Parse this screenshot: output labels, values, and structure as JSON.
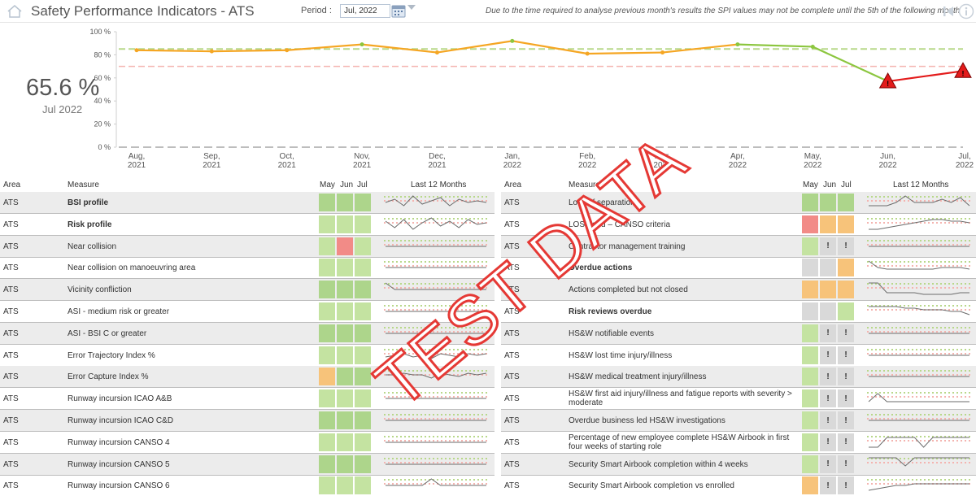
{
  "header": {
    "title": "Safety Performance Indicators - ATS",
    "period_label": "Period :",
    "period_value": "Jul, 2022",
    "notice": "Due to the time required to analyse previous month's results the SPI values may not be complete until the 5th of the following month"
  },
  "kpi": {
    "value": "65.6 %",
    "period": "Jul 2022"
  },
  "chart_data": {
    "type": "line",
    "x": [
      "Aug, 2021",
      "Sep, 2021",
      "Oct, 2021",
      "Nov, 2021",
      "Dec, 2021",
      "Jan, 2022",
      "Feb, 2022",
      "Mar, 2022",
      "Apr, 2022",
      "May, 2022",
      "Jun, 2022",
      "Jul, 2022"
    ],
    "y_ticks": [
      "100 %",
      "80 %",
      "60 %",
      "40 %",
      "20 %",
      "0 %"
    ],
    "ylim": [
      0,
      100
    ],
    "values": [
      84,
      83,
      84,
      89,
      82,
      92,
      81,
      82,
      89,
      87,
      57,
      66
    ],
    "target_line": 85,
    "threshold_line": 70,
    "zero_line": 0,
    "colors": {
      "above": "#8cc63f",
      "near": "#f5a623",
      "below": "#e31b1b",
      "target": "#b8d88a",
      "threshold": "#f4b4b0",
      "baseline": "#bdbdbd"
    },
    "alert_points": [
      10,
      11
    ]
  },
  "left_table": {
    "headers": {
      "area": "Area",
      "measure": "Measure",
      "m1": "May",
      "m2": "Jun",
      "m3": "Jul",
      "trend": "Last 12 Months"
    },
    "rows": [
      {
        "area": "ATS",
        "measure": "BSI profile",
        "bold": true,
        "cells": [
          "dgreen",
          "dgreen",
          "dgreen"
        ],
        "marks": [
          "",
          "",
          ""
        ],
        "spark": [
          5,
          7,
          3,
          9,
          4,
          6,
          8,
          3,
          7,
          5,
          6,
          5
        ]
      },
      {
        "area": "ATS",
        "measure": "Risk profile",
        "bold": true,
        "cells": [
          "green",
          "green",
          "green"
        ],
        "marks": [
          "",
          "",
          ""
        ],
        "spark": [
          7,
          3,
          8,
          2,
          6,
          9,
          4,
          7,
          3,
          8,
          5,
          6
        ]
      },
      {
        "area": "ATS",
        "measure": "Near collision",
        "bold": false,
        "cells": [
          "green",
          "red",
          "green"
        ],
        "marks": [
          "",
          "",
          ""
        ],
        "spark": [
          5,
          5,
          5,
          5,
          5,
          5,
          5,
          5,
          5,
          5,
          5,
          5
        ]
      },
      {
        "area": "ATS",
        "measure": "Near collision on manoeuvring area",
        "bold": false,
        "cells": [
          "green",
          "green",
          "green"
        ],
        "marks": [
          "",
          "",
          ""
        ],
        "spark": [
          5,
          5,
          5,
          5,
          5,
          5,
          5,
          5,
          5,
          5,
          5,
          5
        ]
      },
      {
        "area": "ATS",
        "measure": "Vicinity confliction",
        "bold": false,
        "cells": [
          "dgreen",
          "dgreen",
          "dgreen"
        ],
        "marks": [
          "",
          "",
          ""
        ],
        "spark": [
          9,
          5,
          5,
          5,
          5,
          5,
          5,
          5,
          5,
          5,
          5,
          5
        ]
      },
      {
        "area": "ATS",
        "measure": "ASI - medium risk or greater",
        "bold": false,
        "cells": [
          "green",
          "green",
          "green"
        ],
        "marks": [
          "",
          "",
          ""
        ],
        "spark": [
          5,
          5,
          5,
          5,
          5,
          5,
          5,
          5,
          5,
          5,
          5,
          5
        ]
      },
      {
        "area": "ATS",
        "measure": "ASI - BSI C or greater",
        "bold": false,
        "cells": [
          "dgreen",
          "dgreen",
          "dgreen"
        ],
        "marks": [
          "",
          "",
          ""
        ],
        "spark": [
          5,
          5,
          5,
          5,
          5,
          5,
          5,
          5,
          5,
          5,
          5,
          5
        ]
      },
      {
        "area": "ATS",
        "measure": "Error Trajectory Index %",
        "bold": false,
        "cells": [
          "green",
          "green",
          "green"
        ],
        "marks": [
          "",
          "",
          ""
        ],
        "spark": [
          4,
          5,
          6,
          4,
          5,
          3,
          6,
          5,
          4,
          6,
          5,
          6
        ]
      },
      {
        "area": "ATS",
        "measure": "Error Capture Index %",
        "bold": false,
        "cells": [
          "orange",
          "dgreen",
          "dgreen"
        ],
        "marks": [
          "",
          "",
          ""
        ],
        "spark": [
          6,
          6,
          7,
          6,
          6,
          4,
          7,
          6,
          5,
          7,
          6,
          7
        ]
      },
      {
        "area": "ATS",
        "measure": "Runway incursion ICAO A&B",
        "bold": false,
        "cells": [
          "green",
          "green",
          "green"
        ],
        "marks": [
          "",
          "",
          ""
        ],
        "spark": [
          5,
          5,
          5,
          5,
          5,
          5,
          5,
          5,
          5,
          5,
          5,
          5
        ]
      },
      {
        "area": "ATS",
        "measure": "Runway incursion ICAO C&D",
        "bold": false,
        "cells": [
          "dgreen",
          "dgreen",
          "dgreen"
        ],
        "marks": [
          "",
          "",
          ""
        ],
        "spark": [
          5,
          5,
          5,
          5,
          5,
          5,
          5,
          5,
          5,
          5,
          5,
          5
        ]
      },
      {
        "area": "ATS",
        "measure": "Runway incursion CANSO 4",
        "bold": false,
        "cells": [
          "green",
          "green",
          "green"
        ],
        "marks": [
          "",
          "",
          ""
        ],
        "spark": [
          5,
          5,
          5,
          5,
          5,
          5,
          5,
          5,
          5,
          5,
          5,
          5
        ]
      },
      {
        "area": "ATS",
        "measure": "Runway incursion CANSO 5",
        "bold": false,
        "cells": [
          "dgreen",
          "dgreen",
          "dgreen"
        ],
        "marks": [
          "",
          "",
          ""
        ],
        "spark": [
          5,
          5,
          5,
          5,
          5,
          5,
          5,
          5,
          5,
          5,
          5,
          5
        ]
      },
      {
        "area": "ATS",
        "measure": "Runway incursion CANSO 6",
        "bold": false,
        "cells": [
          "green",
          "green",
          "green"
        ],
        "marks": [
          "",
          "",
          ""
        ],
        "spark": [
          5,
          5,
          5,
          5,
          5,
          9,
          5,
          5,
          5,
          5,
          5,
          5
        ]
      }
    ]
  },
  "right_table": {
    "headers": {
      "area": "Area",
      "measure": "Measure",
      "m1": "May",
      "m2": "Jun",
      "m3": "Jul",
      "trend": "Last 12 Months"
    },
    "rows": [
      {
        "area": "ATS",
        "measure": "Loss of separation",
        "bold": false,
        "cells": [
          "dgreen",
          "dgreen",
          "dgreen"
        ],
        "marks": [
          "",
          "",
          ""
        ],
        "spark": [
          3,
          3,
          3,
          5,
          9,
          5,
          5,
          5,
          7,
          5,
          8,
          3
        ]
      },
      {
        "area": "ATS",
        "measure": "LOS trend – CANSO criteria",
        "bold": false,
        "cells": [
          "red",
          "orange",
          "orange"
        ],
        "marks": [
          "",
          "",
          ""
        ],
        "spark": [
          2,
          2,
          3,
          4,
          5,
          6,
          7,
          8,
          8,
          7,
          7,
          6
        ]
      },
      {
        "area": "ATS",
        "measure": "Contractor management training",
        "bold": false,
        "cells": [
          "green",
          "grey",
          "grey"
        ],
        "marks": [
          "",
          "!",
          "!"
        ],
        "spark": [
          5,
          5,
          5,
          5,
          5,
          5,
          5,
          5,
          5,
          5,
          5,
          5
        ]
      },
      {
        "area": "ATS",
        "measure": "Overdue actions",
        "bold": true,
        "cells": [
          "grey",
          "grey",
          "orange"
        ],
        "marks": [
          "",
          "",
          ""
        ],
        "spark": [
          9,
          5,
          4,
          4,
          4,
          4,
          4,
          4,
          5,
          5,
          5,
          4
        ]
      },
      {
        "area": "ATS",
        "measure": "Actions completed but not closed",
        "bold": false,
        "cells": [
          "orange",
          "orange",
          "orange"
        ],
        "marks": [
          "",
          "",
          ""
        ],
        "spark": [
          9,
          9,
          3,
          3,
          3,
          3,
          2,
          2,
          2,
          2,
          3,
          3
        ]
      },
      {
        "area": "ATS",
        "measure": "Risk reviews overdue",
        "bold": true,
        "cells": [
          "grey",
          "grey",
          "green"
        ],
        "marks": [
          "",
          "",
          ""
        ],
        "spark": [
          8,
          8,
          8,
          8,
          7,
          7,
          6,
          6,
          6,
          5,
          5,
          3
        ]
      },
      {
        "area": "ATS",
        "measure": "HS&W notifiable events",
        "bold": false,
        "cells": [
          "green",
          "grey",
          "grey"
        ],
        "marks": [
          "",
          "!",
          "!"
        ],
        "spark": [
          5,
          5,
          5,
          5,
          5,
          5,
          5,
          5,
          5,
          5,
          5,
          5
        ]
      },
      {
        "area": "ATS",
        "measure": "HS&W lost time injury/illness",
        "bold": false,
        "cells": [
          "green",
          "grey",
          "grey"
        ],
        "marks": [
          "",
          "!",
          "!"
        ],
        "spark": [
          5,
          5,
          5,
          5,
          5,
          5,
          5,
          5,
          5,
          5,
          5,
          5
        ]
      },
      {
        "area": "ATS",
        "measure": "HS&W medical treatment injury/illness",
        "bold": false,
        "cells": [
          "green",
          "grey",
          "grey"
        ],
        "marks": [
          "",
          "!",
          "!"
        ],
        "spark": [
          5,
          5,
          5,
          5,
          5,
          5,
          5,
          5,
          5,
          5,
          5,
          5
        ]
      },
      {
        "area": "ATS",
        "measure": "HS&W first aid injury/illness and fatigue reports with severity > moderate",
        "bold": false,
        "cells": [
          "green",
          "grey",
          "grey"
        ],
        "marks": [
          "",
          "!",
          "!"
        ],
        "spark": [
          3,
          8,
          3,
          3,
          3,
          3,
          3,
          3,
          3,
          3,
          3,
          3
        ]
      },
      {
        "area": "ATS",
        "measure": "Overdue business led HS&W investigations",
        "bold": false,
        "cells": [
          "green",
          "grey",
          "grey"
        ],
        "marks": [
          "",
          "!",
          "!"
        ],
        "spark": [
          5,
          5,
          5,
          5,
          5,
          5,
          5,
          5,
          5,
          5,
          5,
          5
        ]
      },
      {
        "area": "ATS",
        "measure": "Percentage of new employee complete HS&W Airbook in first four weeks of starting role",
        "bold": false,
        "cells": [
          "green",
          "grey",
          "grey"
        ],
        "marks": [
          "",
          "!",
          "!"
        ],
        "spark": [
          2,
          2,
          8,
          8,
          8,
          8,
          2,
          8,
          8,
          8,
          8,
          8
        ]
      },
      {
        "area": "ATS",
        "measure": "Security Smart Airbook completion within 4 weeks",
        "bold": false,
        "cells": [
          "green",
          "grey",
          "grey"
        ],
        "marks": [
          "",
          "!",
          "!"
        ],
        "spark": [
          9,
          9,
          9,
          9,
          4,
          9,
          9,
          9,
          9,
          9,
          9,
          9
        ]
      },
      {
        "area": "ATS",
        "measure": "Security Smart Airbook completion vs enrolled",
        "bold": false,
        "cells": [
          "orange",
          "grey",
          "grey"
        ],
        "marks": [
          "",
          "!",
          "!"
        ],
        "spark": [
          2,
          3,
          4,
          5,
          5,
          6,
          6,
          6,
          6,
          6,
          6,
          6
        ]
      }
    ]
  },
  "watermark": "TEST DATA"
}
